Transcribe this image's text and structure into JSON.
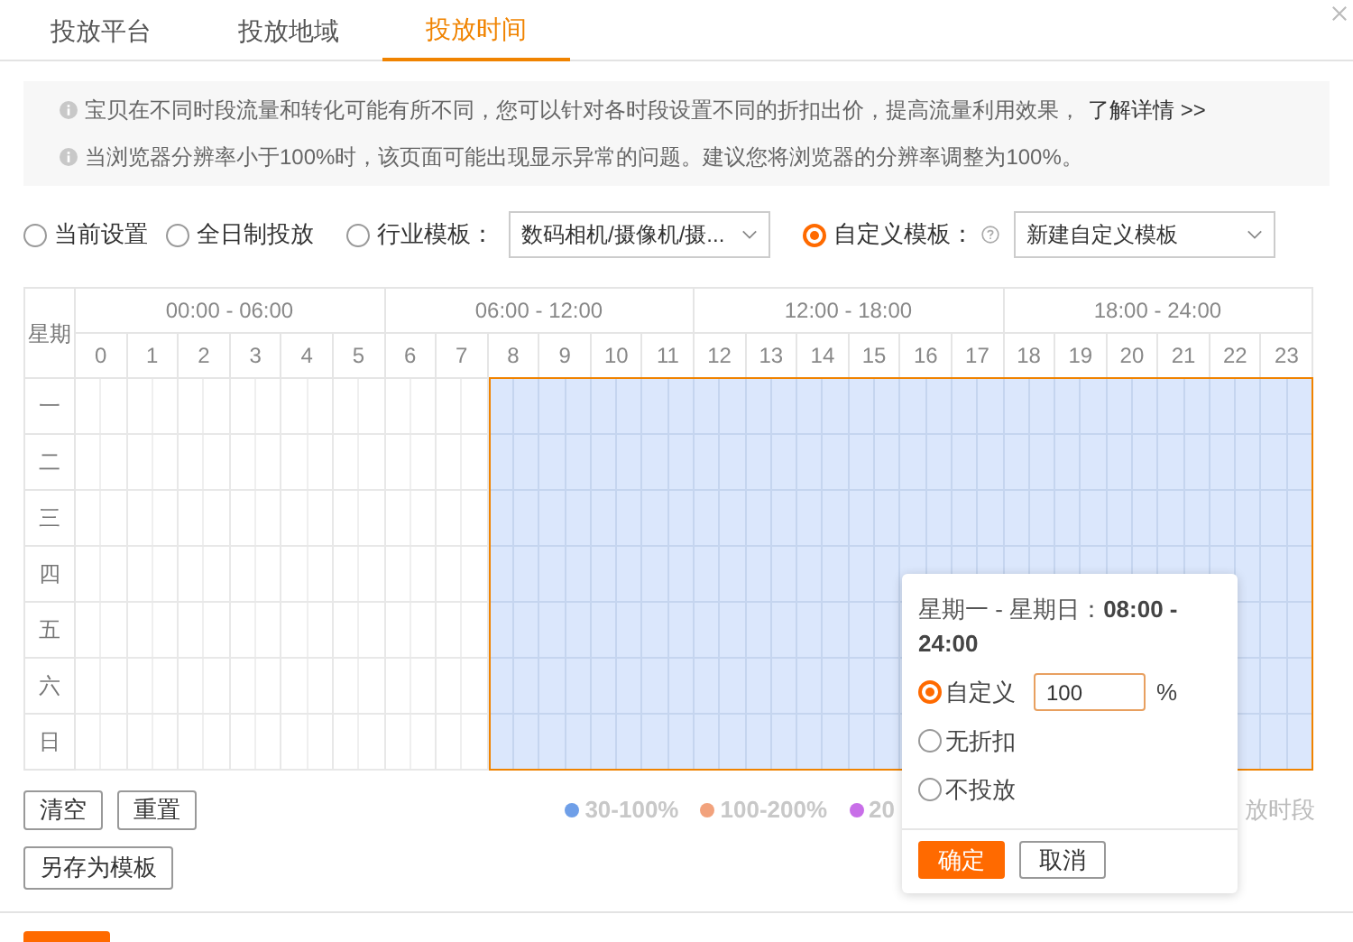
{
  "tabs": [
    {
      "label": "投放平台",
      "selected": false
    },
    {
      "label": "投放地域",
      "selected": false
    },
    {
      "label": "投放时间",
      "selected": true
    }
  ],
  "notices": [
    {
      "text": "宝贝在不同时段流量和转化可能有所不同，您可以针对各时段设置不同的折扣出价，提高流量利用效果，",
      "link": "了解详情 >>"
    },
    {
      "text": "当浏览器分辨率小于100%时，该页面可能出现显示异常的问题。建议您将浏览器的分辨率调整为100%。"
    }
  ],
  "modes": [
    {
      "label": "当前设置",
      "selected": false,
      "help": false
    },
    {
      "label": "全日制投放",
      "selected": false,
      "help": false
    },
    {
      "label": "行业模板：",
      "selected": false,
      "help": false,
      "dropdown": "数码相机/摄像机/摄..."
    },
    {
      "label": "自定义模板：",
      "selected": true,
      "help": true,
      "dropdown": "新建自定义模板"
    }
  ],
  "schedule": {
    "corner": "星期",
    "groups": [
      "00:00 - 06:00",
      "06:00 - 12:00",
      "12:00 - 18:00",
      "18:00 - 24:00"
    ],
    "hours": [
      {
        "label": "0",
        "selected": false
      },
      {
        "label": "1",
        "selected": false
      },
      {
        "label": "2",
        "selected": false
      },
      {
        "label": "3",
        "selected": false
      },
      {
        "label": "4",
        "selected": false
      },
      {
        "label": "5",
        "selected": false
      },
      {
        "label": "6",
        "selected": false
      },
      {
        "label": "7",
        "selected": false
      },
      {
        "label": "8",
        "selected": true
      },
      {
        "label": "9",
        "selected": true
      },
      {
        "label": "10",
        "selected": true
      },
      {
        "label": "11",
        "selected": true
      },
      {
        "label": "12",
        "selected": true
      },
      {
        "label": "13",
        "selected": true
      },
      {
        "label": "14",
        "selected": true
      },
      {
        "label": "15",
        "selected": true
      },
      {
        "label": "16",
        "selected": true
      },
      {
        "label": "17",
        "selected": true
      },
      {
        "label": "18",
        "selected": true
      },
      {
        "label": "19",
        "selected": true
      },
      {
        "label": "20",
        "selected": true
      },
      {
        "label": "21",
        "selected": true
      },
      {
        "label": "22",
        "selected": true
      },
      {
        "label": "23",
        "selected": true
      }
    ],
    "days": [
      "一",
      "二",
      "三",
      "四",
      "五",
      "六",
      "日"
    ]
  },
  "actions": [
    "清空",
    "重置"
  ],
  "save_button": "另存为模板",
  "legend": [
    {
      "label": "30-100%",
      "color": "#6f9fe8"
    },
    {
      "label": "100-200%",
      "color": "#f2a27c"
    },
    {
      "label": "20",
      "color": "#c86ee8"
    }
  ],
  "legend_tail": "放时段",
  "popup": {
    "title": "星期一 - 星期日：",
    "range": "08:00 - 24:00",
    "options": [
      {
        "label": "自定义",
        "selected": true,
        "value": "100",
        "unit": "%"
      },
      {
        "label": "无折扣",
        "selected": false
      },
      {
        "label": "不投放",
        "selected": false
      }
    ],
    "confirm": "确定",
    "cancel": "取消"
  }
}
